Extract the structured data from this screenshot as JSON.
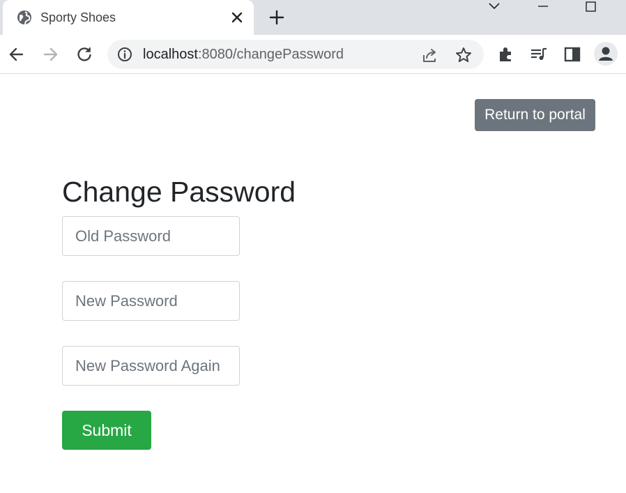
{
  "browser": {
    "tab": {
      "title": "Sporty Shoes",
      "favicon": "globe-icon"
    },
    "url": {
      "host": "localhost",
      "rest": ":8080/changePassword"
    },
    "icons": [
      "back-arrow-icon",
      "forward-arrow-icon",
      "reload-icon",
      "info-icon",
      "share-icon",
      "star-icon",
      "extensions-icon",
      "media-queue-icon",
      "side-panel-icon",
      "profile-icon"
    ]
  },
  "page": {
    "return_button": "Return to portal",
    "title": "Change Password",
    "fields": {
      "old_password": {
        "placeholder": "Old Password",
        "value": ""
      },
      "new_password": {
        "placeholder": "New Password",
        "value": ""
      },
      "new_password_again": {
        "placeholder": "New Password Again",
        "value": ""
      }
    },
    "submit_label": "Submit"
  },
  "colors": {
    "return_button_bg": "#6c757d",
    "submit_button_bg": "#28a745",
    "tabstrip_bg": "#dee1e6",
    "omnibox_bg": "#f1f3f4",
    "title_text": "#212529"
  }
}
